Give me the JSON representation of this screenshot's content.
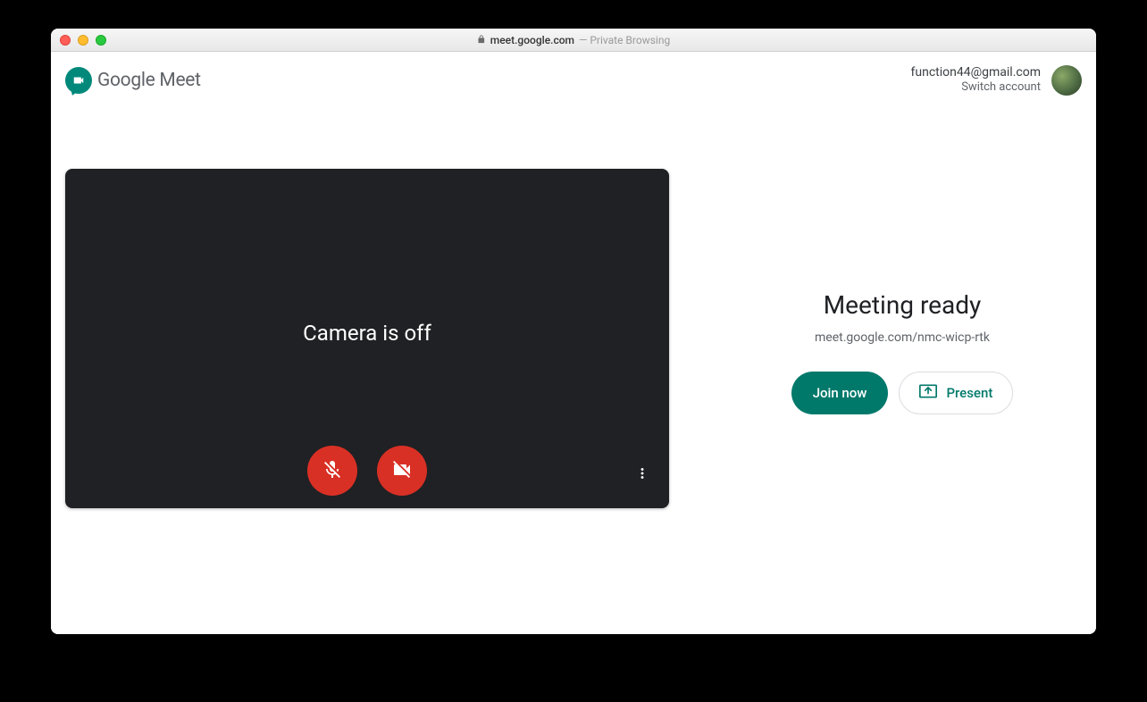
{
  "browser": {
    "domain": "meet.google.com",
    "suffix": " — Private Browsing"
  },
  "header": {
    "product_name_google": "Google ",
    "product_name_meet": "Meet",
    "account_email": "function44@gmail.com",
    "switch_account": "Switch account"
  },
  "preview": {
    "camera_off": "Camera is off"
  },
  "meeting": {
    "title": "Meeting ready",
    "url": "meet.google.com/nmc-wicp-rtk",
    "join_label": "Join now",
    "present_label": "Present"
  }
}
